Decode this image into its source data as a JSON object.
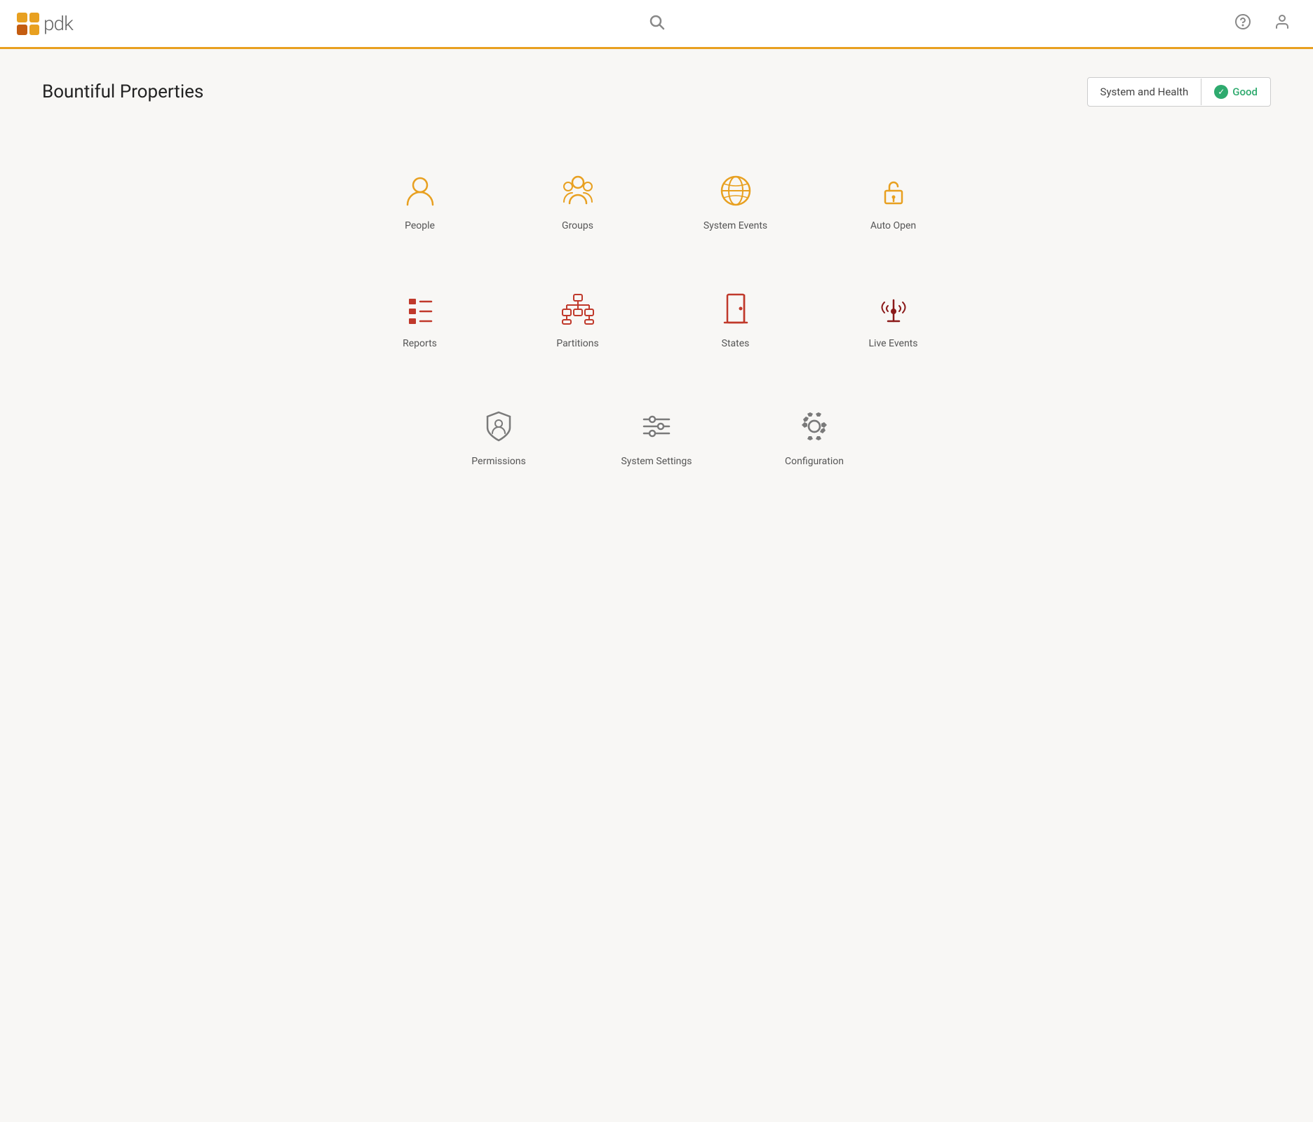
{
  "header": {
    "logo_text": "pdk",
    "search_aria": "Search",
    "help_aria": "Help",
    "user_aria": "User Account"
  },
  "page": {
    "title": "Bountiful Properties",
    "system_health_label": "System and Health",
    "system_health_status": "Good"
  },
  "nav_items_row1": [
    {
      "id": "people",
      "label": "People",
      "color": "orange"
    },
    {
      "id": "groups",
      "label": "Groups",
      "color": "orange"
    },
    {
      "id": "system-events",
      "label": "System Events",
      "color": "orange"
    },
    {
      "id": "auto-open",
      "label": "Auto Open",
      "color": "orange"
    }
  ],
  "nav_items_row2": [
    {
      "id": "reports",
      "label": "Reports",
      "color": "red"
    },
    {
      "id": "partitions",
      "label": "Partitions",
      "color": "red"
    },
    {
      "id": "states",
      "label": "States",
      "color": "red"
    },
    {
      "id": "live-events",
      "label": "Live Events",
      "color": "dark-red"
    }
  ],
  "nav_items_row3": [
    {
      "id": "permissions",
      "label": "Permissions",
      "color": "gray"
    },
    {
      "id": "system-settings",
      "label": "System Settings",
      "color": "gray"
    },
    {
      "id": "configuration",
      "label": "Configuration",
      "color": "gray"
    }
  ]
}
